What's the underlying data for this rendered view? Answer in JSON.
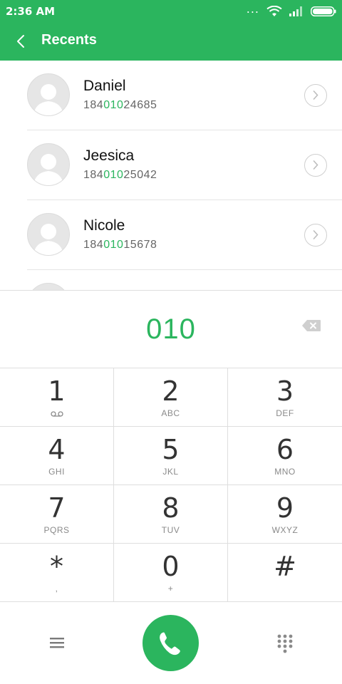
{
  "status": {
    "time": "2:36 AM",
    "dots": "..."
  },
  "appbar": {
    "title": "Recents"
  },
  "contacts": [
    {
      "name": "Daniel",
      "number_prefix": "184",
      "number_match": "010",
      "number_suffix": "24685"
    },
    {
      "name": "Jeesica",
      "number_prefix": "184",
      "number_match": "010",
      "number_suffix": "25042"
    },
    {
      "name": "Nicole",
      "number_prefix": "184",
      "number_match": "010",
      "number_suffix": "15678"
    }
  ],
  "dialer": {
    "entered_number": "010"
  },
  "keypad": [
    {
      "digit": "1",
      "letters": ""
    },
    {
      "digit": "2",
      "letters": "ABC"
    },
    {
      "digit": "3",
      "letters": "DEF"
    },
    {
      "digit": "4",
      "letters": "GHI"
    },
    {
      "digit": "5",
      "letters": "JKL"
    },
    {
      "digit": "6",
      "letters": "MNO"
    },
    {
      "digit": "7",
      "letters": "PQRS"
    },
    {
      "digit": "8",
      "letters": "TUV"
    },
    {
      "digit": "9",
      "letters": "WXYZ"
    },
    {
      "digit": "*",
      "letters": ","
    },
    {
      "digit": "0",
      "letters": "+"
    },
    {
      "digit": "#",
      "letters": ""
    }
  ],
  "colors": {
    "accent": "#2bb55e"
  }
}
